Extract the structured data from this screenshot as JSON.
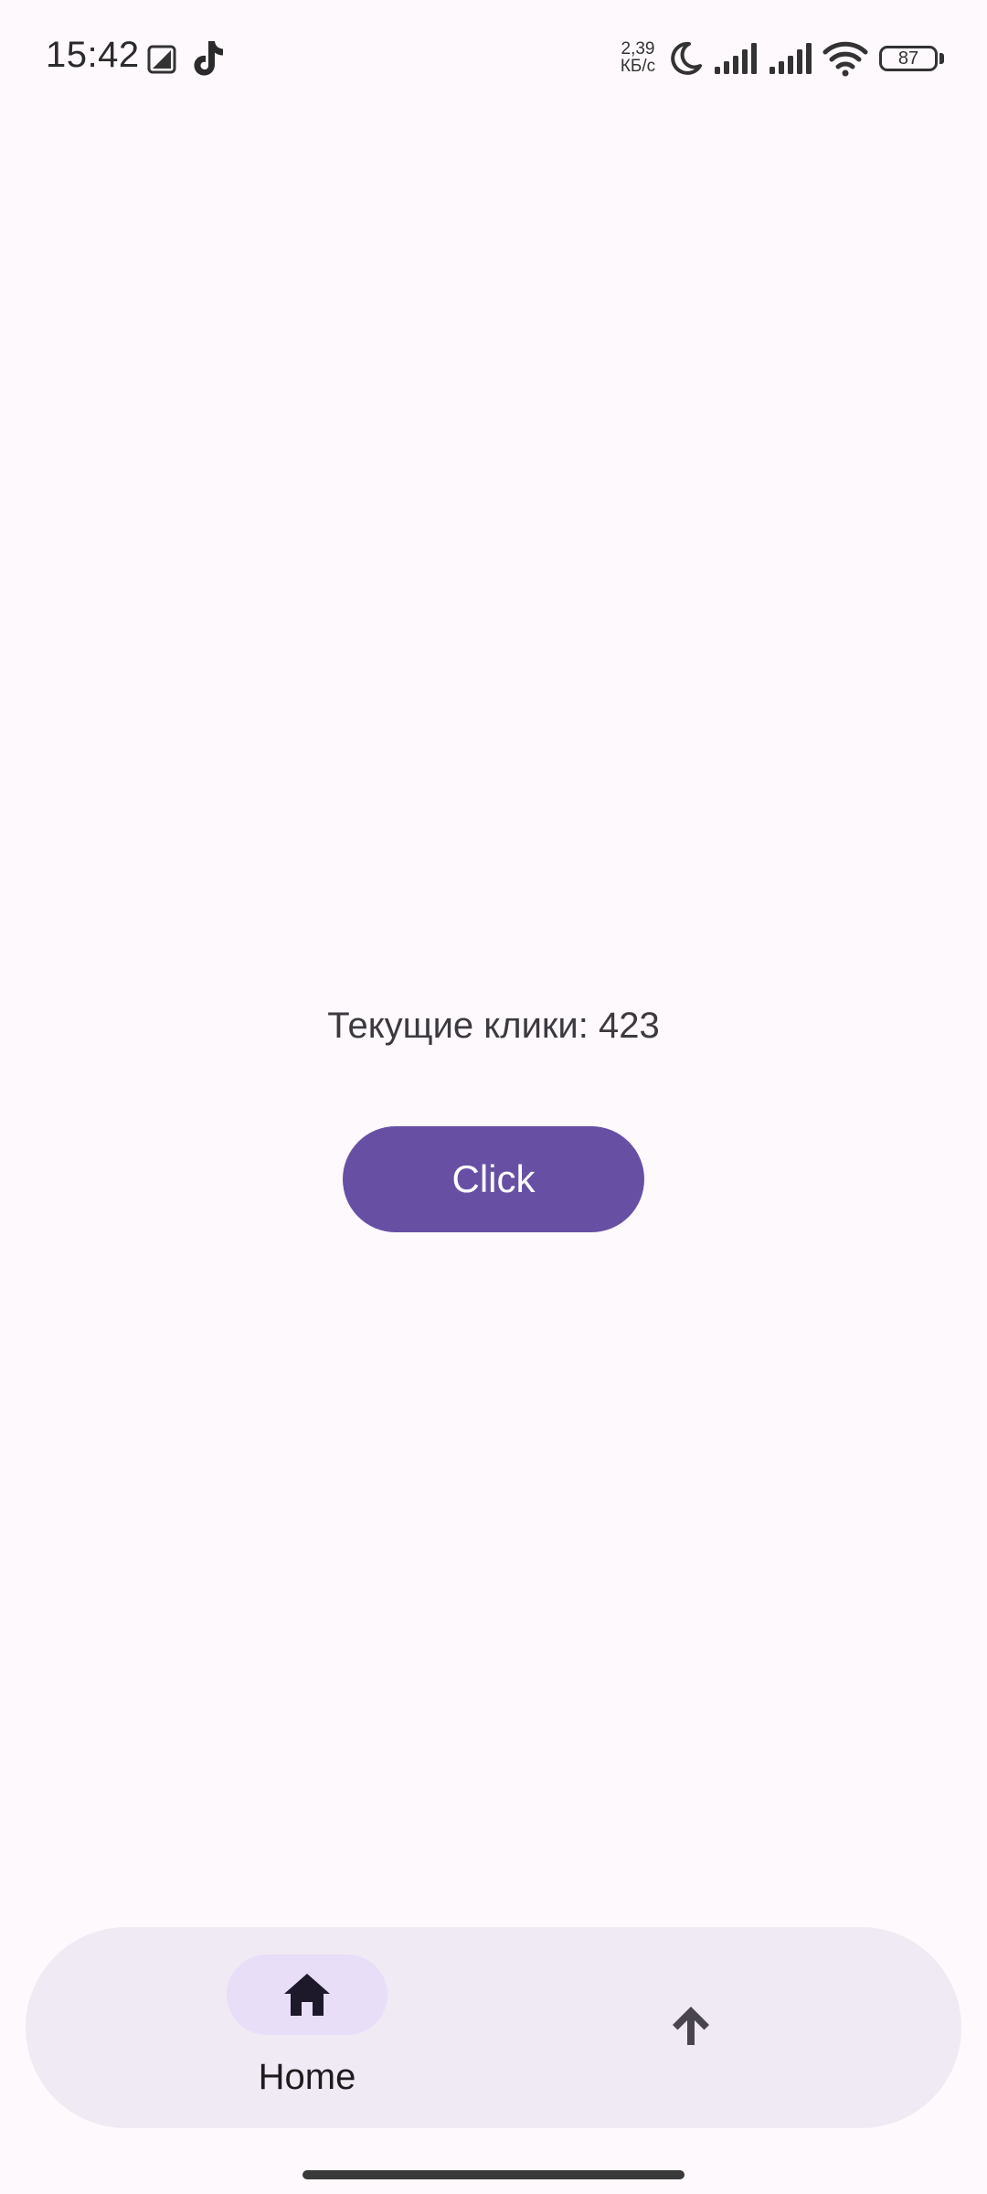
{
  "status_bar": {
    "time": "15:42",
    "net_speed_value": "2,39",
    "net_speed_unit": "КБ/с",
    "battery_level": "87",
    "icons": [
      "gallery-notification-icon",
      "tiktok-icon",
      "moon-icon",
      "signal-icon",
      "signal-icon",
      "wifi-icon",
      "battery-icon"
    ]
  },
  "main": {
    "counter_text": "Текущие клики: 423",
    "click_button_label": "Click"
  },
  "bottom_nav": {
    "items": [
      {
        "label": "Home",
        "icon": "home-icon",
        "selected": true
      },
      {
        "label": "",
        "icon": "arrow-up-icon",
        "selected": false
      }
    ]
  },
  "colors": {
    "background": "#FEF9FC",
    "primary": "#6750A4",
    "nav_background": "#F0EAF4",
    "nav_indicator": "#E8DEF8"
  }
}
